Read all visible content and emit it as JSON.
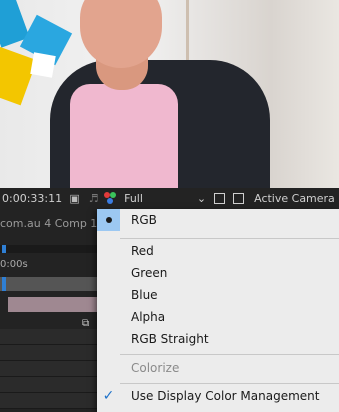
{
  "viewer": {
    "timecode": "0:00:33:11",
    "resolution": "Full",
    "camera": "Active Camera",
    "icons": [
      "camera-icon",
      "snapshot-icon",
      "rgb-channels-icon",
      "chevron-down-icon",
      "region-icon",
      "transparency-grid-icon"
    ]
  },
  "timeline": {
    "comp_tab": "com.au 4 Comp 1",
    "time_label": "0:00s"
  },
  "menu": {
    "items": [
      {
        "label": "RGB",
        "selected": true
      },
      {
        "label": "Red"
      },
      {
        "label": "Green"
      },
      {
        "label": "Blue"
      },
      {
        "label": "Alpha"
      },
      {
        "label": "RGB Straight"
      },
      {
        "label": "Colorize",
        "disabled": true
      },
      {
        "label": "Use Display Color Management",
        "checked": true
      }
    ]
  },
  "colors": {
    "menu_bg": "#ececec",
    "selection": "#9cc8f2",
    "check": "#1f72c9",
    "toolbar_bg": "#232323"
  }
}
